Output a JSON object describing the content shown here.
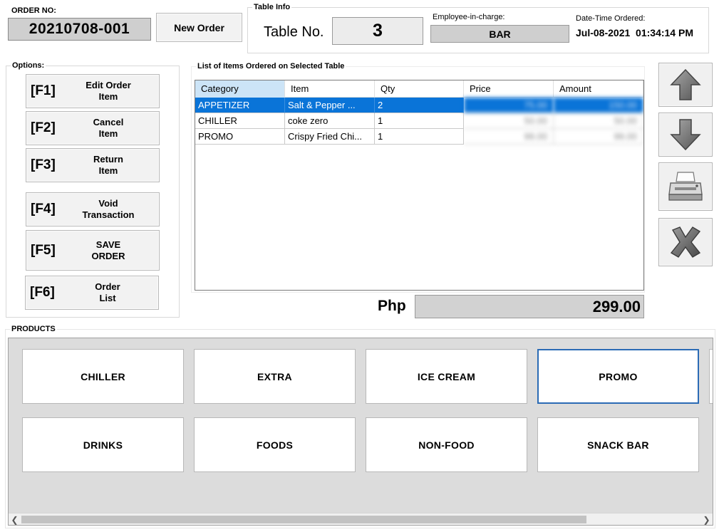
{
  "header": {
    "order_no_label": "ORDER NO:",
    "order_no": "20210708-001",
    "new_order_label": "New Order",
    "table_info_title": "Table Info",
    "table_no_label": "Table No.",
    "table_no": "3",
    "employee_label": "Employee-in-charge:",
    "employee": "BAR",
    "datetime_label": "Date-Time Ordered:",
    "datetime": "Jul-08-2021  01:34:14 PM"
  },
  "options": {
    "title": "Options:",
    "buttons": [
      {
        "key": "[F1]",
        "label": "Edit Order\nItem"
      },
      {
        "key": "[F2]",
        "label": "Cancel\nItem"
      },
      {
        "key": "[F3]",
        "label": "Return\nItem"
      },
      {
        "key": "[F4]",
        "label": "Void\nTransaction"
      },
      {
        "key": "[F5]",
        "label": "SAVE\nORDER"
      },
      {
        "key": "[F6]",
        "label": "Order\nList"
      }
    ]
  },
  "items": {
    "title": "List of Items Ordered on Selected Table",
    "columns": [
      "Category",
      "Item",
      "Qty",
      "Price",
      "Amount"
    ],
    "rows": [
      {
        "category": "APPETIZER",
        "item": "Salt & Pepper ...",
        "qty": "2",
        "price": "75.00",
        "amount": "150.00"
      },
      {
        "category": "CHILLER",
        "item": "coke zero",
        "qty": "1",
        "price": "50.00",
        "amount": "50.00"
      },
      {
        "category": "PROMO",
        "item": "Crispy Fried Chi...",
        "qty": "1",
        "price": "99.00",
        "amount": "99.00"
      }
    ],
    "selected_row": 0
  },
  "side_buttons": [
    {
      "icon": "arrow-up-icon"
    },
    {
      "icon": "arrow-down-icon"
    },
    {
      "icon": "printer-icon"
    },
    {
      "icon": "close-x-icon"
    }
  ],
  "total": {
    "currency": "Php",
    "amount": "299.00"
  },
  "products": {
    "title": "PRODUCTS",
    "items": [
      "CHILLER",
      "EXTRA",
      "ICE CREAM",
      "PROMO",
      "DRINKS",
      "FOODS",
      "NON-FOOD",
      "SNACK BAR"
    ],
    "selected": "PROMO"
  },
  "colors": {
    "selection_blue": "#0a74d8",
    "header_highlight": "#cce4f7",
    "selected_product_border": "#2b6bb5"
  }
}
